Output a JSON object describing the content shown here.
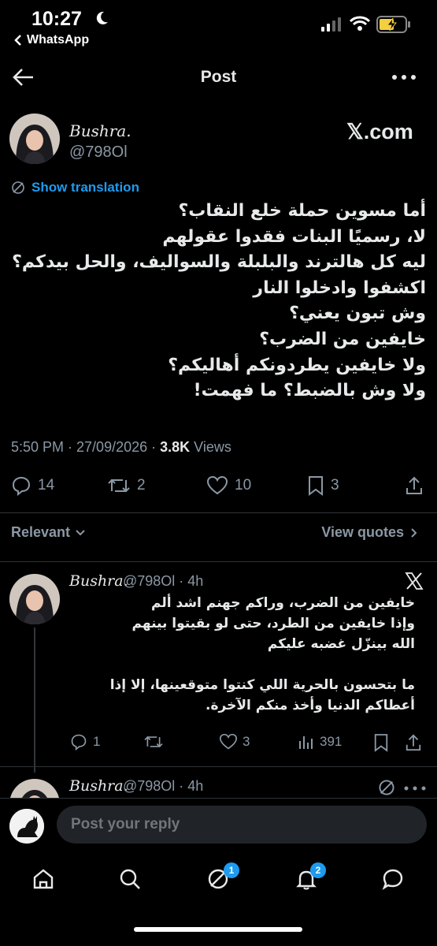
{
  "status_bar": {
    "time": "10:27",
    "back_app": "WhatsApp"
  },
  "topbar": {
    "title": "Post"
  },
  "post": {
    "author_name": "Bushra.",
    "author_handle": "@798Ol",
    "source_label": "𝕏.com",
    "translate_label": "Show translation",
    "lines": [
      "أما مسوين حملة خلع النقاب؟",
      "لا، رسميًا البنات فقدوا عقولهم",
      "ليه كل هالترند والبلبلة والسواليف، والحل بيدكم؟",
      "اكشفوا وادخلوا النار",
      "وش تبون يعني؟",
      "خايفين من الضرب؟",
      "ولا خايفين يطردونكم أهاليكم؟",
      "ولا وش بالضبط؟ ما فهمت!"
    ],
    "timestamp": "5:50 PM · 27/09/2026 · ",
    "views_count": "3.8K",
    "views_label": " Views",
    "replies": "14",
    "reposts": "2",
    "likes": "10",
    "bookmarks": "3"
  },
  "sort": {
    "label": "Relevant",
    "view_quotes": "View quotes"
  },
  "reply": {
    "author_name": "Bushra.",
    "meta": "@798Ol · 4h",
    "lines": [
      "خايفين من الضرب، وراكم جهنم اشد ألم",
      "وإذا خايفين من الطرد، حتى لو بقيتوا بينهم",
      "الله بينزّل غضبه عليكم",
      "",
      "ما بتحسون بالحرية اللي كنتوا متوقعينها، إلا إذا",
      "أعطاكم الدنيا وأخذ منكم الآخرة."
    ],
    "replies": "1",
    "reposts": "",
    "likes": "3",
    "views": "391"
  },
  "reply2": {
    "author_name": "Bushra.",
    "meta": "@798Ol · 4h"
  },
  "composer": {
    "placeholder": "Post your reply"
  },
  "tabs": {
    "messages_badge": "1",
    "notifications_badge": "2"
  },
  "colors": {
    "accent": "#1d9bf0",
    "muted": "#8b98a5",
    "background": "#000000"
  }
}
